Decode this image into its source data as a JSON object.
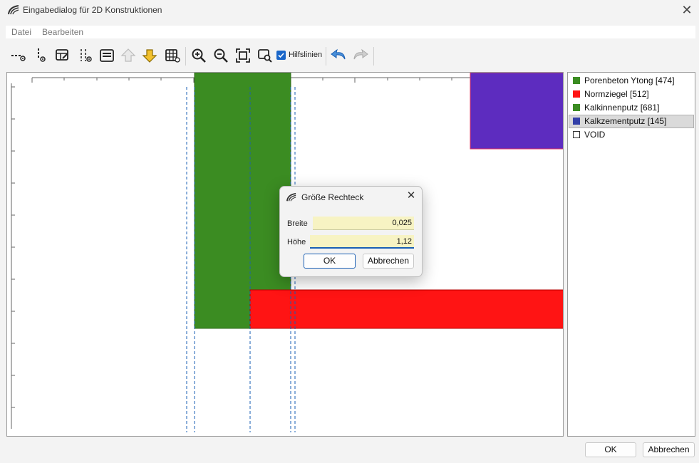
{
  "window": {
    "title": "Eingabedialog für 2D Konstruktionen"
  },
  "menu": {
    "items": [
      "Datei",
      "Bearbeiten"
    ]
  },
  "toolbar": {
    "icons": [
      "point-line-icon",
      "point-vertical-icon",
      "edit-table-icon",
      "split-icon",
      "list-icon",
      "arrow-up-icon",
      "arrow-down-icon",
      "grid-icon",
      "zoom-in-icon",
      "zoom-out-icon",
      "zoom-fit-icon",
      "zoom-window-icon",
      "undo-icon",
      "redo-icon"
    ],
    "hilfslinien_label": "Hilfslinien",
    "hilfslinien_checked": true
  },
  "legend": {
    "items": [
      {
        "label": "Porenbeton Ytong [474]",
        "color": "#3b8c22",
        "selected": false
      },
      {
        "label": "Normziegel [512]",
        "color": "#ff1414",
        "selected": false
      },
      {
        "label": "Kalkinnenputz [681]",
        "color": "#3b8c22",
        "selected": false
      },
      {
        "label": "Kalkzementputz [145]",
        "color": "#3340a8",
        "selected": true
      },
      {
        "label": "VOID",
        "color": "#ffffff",
        "selected": false
      }
    ]
  },
  "canvas": {
    "colors": {
      "green": "#3b8c22",
      "red": "#ff1414",
      "purple": "#5d2cbf",
      "guide": "#1a5fb4"
    }
  },
  "dialog": {
    "title": "Größe Rechteck",
    "breite_label": "Breite",
    "breite_value": "0,025",
    "hoehe_label": "Höhe",
    "hoehe_value": "1,12",
    "ok_label": "OK",
    "cancel_label": "Abbrechen"
  },
  "footer": {
    "ok_label": "OK",
    "cancel_label": "Abbrechen"
  }
}
